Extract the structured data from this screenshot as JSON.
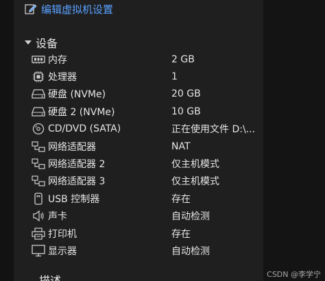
{
  "edit_link": {
    "label": "编辑虚拟机设置",
    "icon": "edit-settings-icon"
  },
  "section": {
    "title": "设备",
    "expanded": true
  },
  "devices": [
    {
      "name": "内存",
      "value": "2 GB",
      "icon": "memory-icon"
    },
    {
      "name": "处理器",
      "value": "1",
      "icon": "processor-icon"
    },
    {
      "name": "硬盘 (NVMe)",
      "value": "20 GB",
      "icon": "hard-disk-icon"
    },
    {
      "name": "硬盘 2 (NVMe)",
      "value": "10 GB",
      "icon": "hard-disk-icon"
    },
    {
      "name": "CD/DVD (SATA)",
      "value": "正在使用文件 D:\\...",
      "icon": "cd-dvd-icon"
    },
    {
      "name": "网络适配器",
      "value": "NAT",
      "icon": "network-adapter-icon"
    },
    {
      "name": "网络适配器 2",
      "value": "仅主机模式",
      "icon": "network-adapter-icon"
    },
    {
      "name": "网络适配器 3",
      "value": "仅主机模式",
      "icon": "network-adapter-icon"
    },
    {
      "name": "USB 控制器",
      "value": "存在",
      "icon": "usb-controller-icon"
    },
    {
      "name": "声卡",
      "value": "自动检测",
      "icon": "sound-card-icon"
    },
    {
      "name": "打印机",
      "value": "存在",
      "icon": "printer-icon"
    },
    {
      "name": "显示器",
      "value": "自动检测",
      "icon": "display-icon"
    }
  ],
  "next_section": {
    "title": "描述"
  },
  "watermark": "CSDN @李学宁",
  "colors": {
    "link": "#5aa0ff",
    "background": "#1f1f1f",
    "text": "#e6e6e6"
  }
}
